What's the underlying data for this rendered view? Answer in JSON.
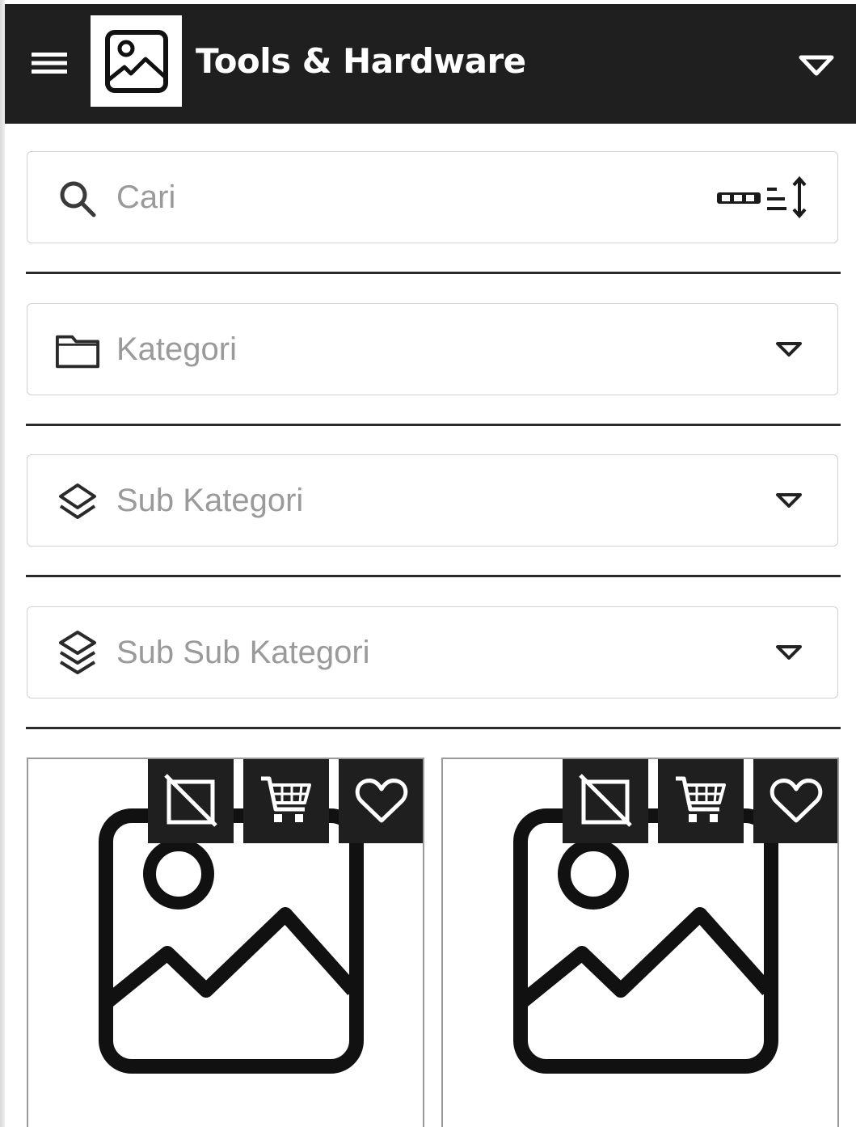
{
  "header": {
    "title": "Tools & Hardware",
    "menu_icon": "hamburger-icon",
    "logo_icon": "image-placeholder-icon",
    "dropdown_icon": "caret-down-icon",
    "background": "#1f1f1f"
  },
  "search": {
    "placeholder": "Cari",
    "icon": "search-icon",
    "barcode_icon": "barcode-scan-icon"
  },
  "filters": [
    {
      "label": "Kategori",
      "icon": "folder-icon"
    },
    {
      "label": "Sub Kategori",
      "icon": "layers-icon"
    },
    {
      "label": "Sub Sub Kategori",
      "icon": "layers-triple-icon"
    }
  ],
  "products": [
    {
      "image_icon": "image-placeholder-icon",
      "actions": [
        "image-off-icon",
        "cart-icon",
        "heart-icon"
      ]
    },
    {
      "image_icon": "image-placeholder-icon",
      "actions": [
        "image-off-icon",
        "cart-icon",
        "heart-icon"
      ]
    }
  ]
}
